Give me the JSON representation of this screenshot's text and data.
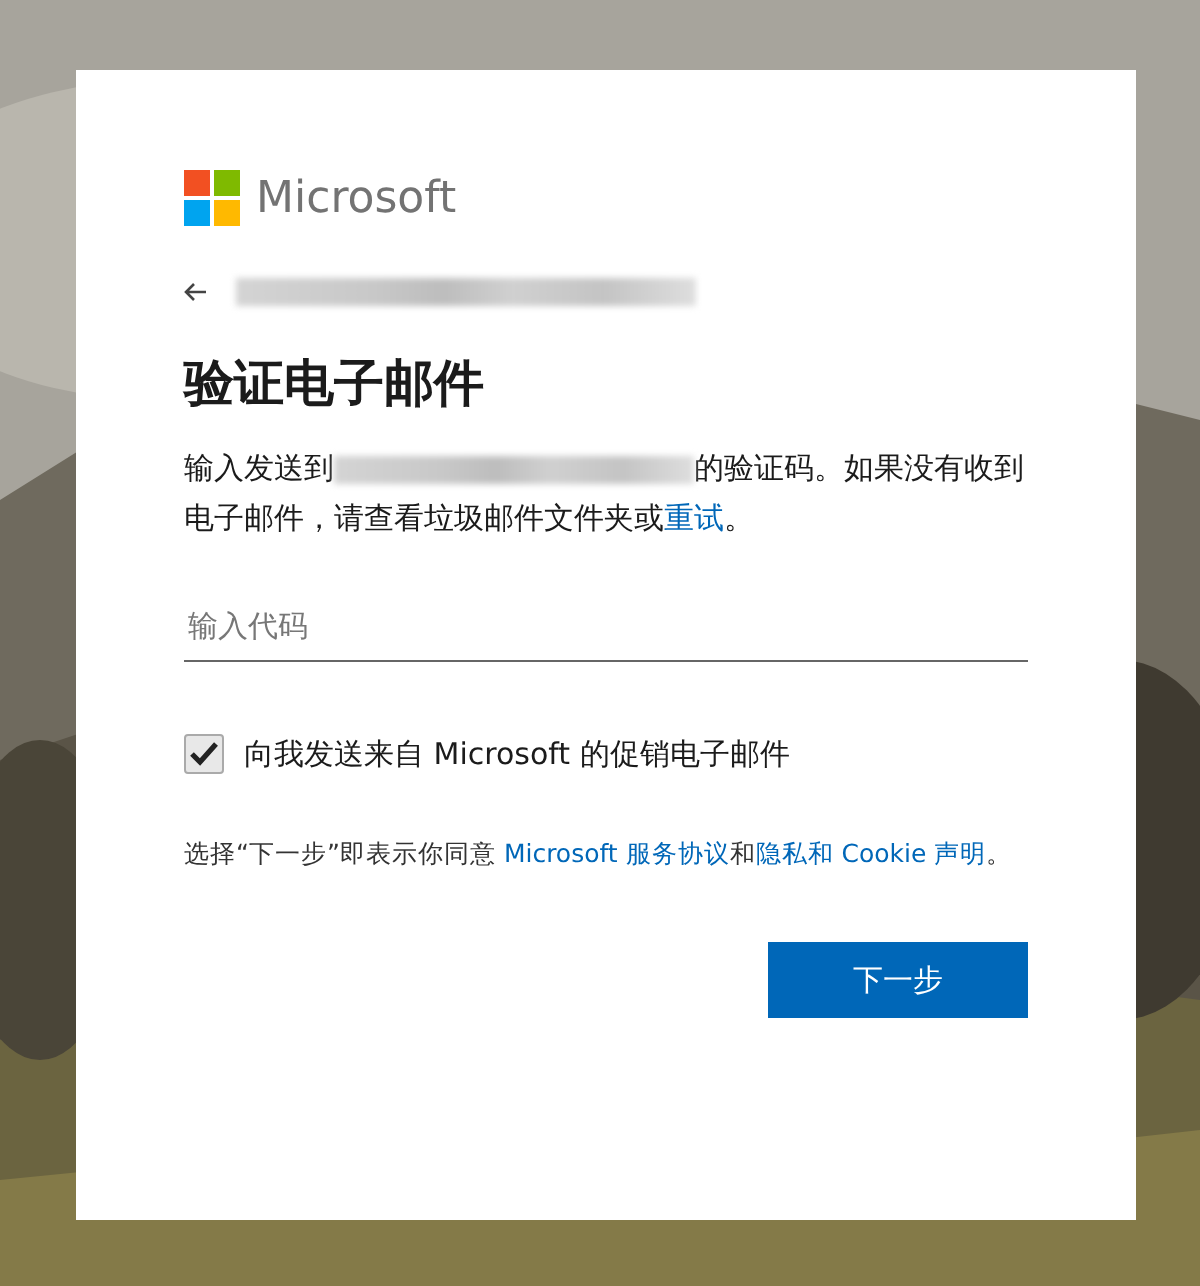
{
  "brand": {
    "name": "Microsoft"
  },
  "title": "验证电子邮件",
  "message": [
    {
      "kind": "text",
      "text": "输入发送到"
    },
    {
      "kind": "redacted"
    },
    {
      "kind": "text",
      "text": "的验证码。如果没有收到电子邮件，请查看垃圾邮件文件夹或"
    },
    {
      "kind": "link",
      "text": "重试"
    },
    {
      "kind": "text",
      "text": "。"
    }
  ],
  "code_field": {
    "placeholder": "输入代码"
  },
  "promo_checkbox": {
    "label": "向我发送来自 Microsoft 的促销电子邮件",
    "checked": true
  },
  "terms": [
    {
      "kind": "text",
      "text": "选择“下一步”即表示你同意 "
    },
    {
      "kind": "link",
      "text": "Microsoft 服务协议"
    },
    {
      "kind": "text",
      "text": "和"
    },
    {
      "kind": "link",
      "text": "隐私和 Cookie 声明"
    },
    {
      "kind": "text",
      "text": "。"
    }
  ],
  "next_button": "下一步"
}
